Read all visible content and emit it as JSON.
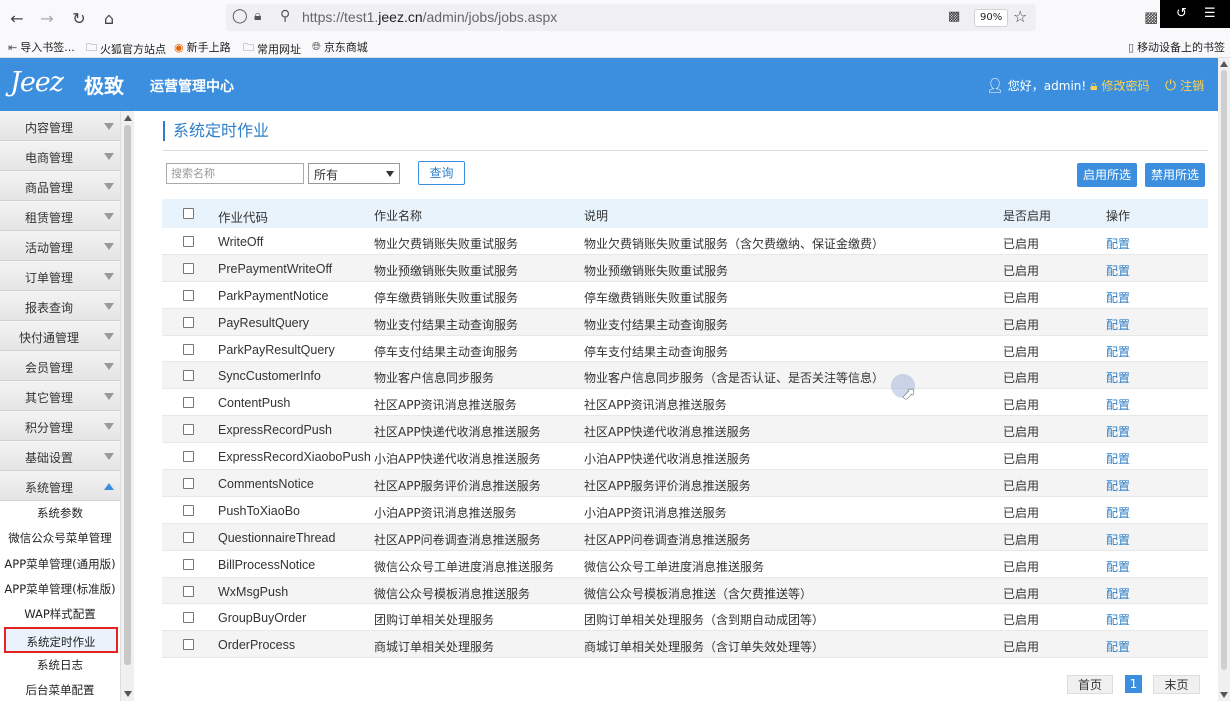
{
  "browser": {
    "url_prefix": "https://test1.",
    "url_domain": "jeez.cn",
    "url_suffix": "/admin/jobs/jobs.aspx",
    "zoom": "90%",
    "bookmarks": [
      "导入书签...",
      "火狐官方站点",
      "新手上路",
      "常用网址",
      "京东商城"
    ],
    "mobile_bookmarks": "移动设备上的书签"
  },
  "header": {
    "logo_en": "Jeez",
    "logo_cn": "极致",
    "center_title": "运营管理中心",
    "greeting": "您好，admin!",
    "change_password": "修改密码",
    "logout": "注销"
  },
  "sidebar": {
    "menus": [
      "内容管理",
      "电商管理",
      "商品管理",
      "租赁管理",
      "活动管理",
      "订单管理",
      "报表查询",
      "快付通管理",
      "会员管理",
      "其它管理",
      "积分管理",
      "基础设置"
    ],
    "expanded_menu": "系统管理",
    "sub_items": [
      "系统参数",
      "微信公众号菜单管理",
      "APP菜单管理(通用版)",
      "APP菜单管理(标准版)",
      "WAP样式配置",
      "系统定时作业",
      "系统日志",
      "后台菜单配置"
    ],
    "active_sub": "系统定时作业"
  },
  "page": {
    "title": "系统定时作业",
    "search_placeholder": "搜索名称",
    "filter_selected": "所有",
    "query_button": "查询",
    "enable_selected": "启用所选",
    "disable_selected": "禁用所选"
  },
  "table": {
    "headers": {
      "code": "作业代码",
      "name": "作业名称",
      "desc": "说明",
      "enabled": "是否启用",
      "op": "操作"
    },
    "rows": [
      {
        "code": "WriteOff",
        "name": "物业欠费销账失败重试服务",
        "desc": "物业欠费销账失败重试服务（含欠费缴纳、保证金缴费）",
        "enabled": "已启用",
        "op": "配置"
      },
      {
        "code": "PrePaymentWriteOff",
        "name": "物业预缴销账失败重试服务",
        "desc": "物业预缴销账失败重试服务",
        "enabled": "已启用",
        "op": "配置"
      },
      {
        "code": "ParkPaymentNotice",
        "name": "停车缴费销账失败重试服务",
        "desc": "停车缴费销账失败重试服务",
        "enabled": "已启用",
        "op": "配置"
      },
      {
        "code": "PayResultQuery",
        "name": "物业支付结果主动查询服务",
        "desc": "物业支付结果主动查询服务",
        "enabled": "已启用",
        "op": "配置"
      },
      {
        "code": "ParkPayResultQuery",
        "name": "停车支付结果主动查询服务",
        "desc": "停车支付结果主动查询服务",
        "enabled": "已启用",
        "op": "配置"
      },
      {
        "code": "SyncCustomerInfo",
        "name": "物业客户信息同步服务",
        "desc": "物业客户信息同步服务（含是否认证、是否关注等信息）",
        "enabled": "已启用",
        "op": "配置"
      },
      {
        "code": "ContentPush",
        "name": "社区APP资讯消息推送服务",
        "desc": "社区APP资讯消息推送服务",
        "enabled": "已启用",
        "op": "配置"
      },
      {
        "code": "ExpressRecordPush",
        "name": "社区APP快递代收消息推送服务",
        "desc": "社区APP快递代收消息推送服务",
        "enabled": "已启用",
        "op": "配置"
      },
      {
        "code": "ExpressRecordXiaoboPush",
        "name": "小泊APP快递代收消息推送服务",
        "desc": "小泊APP快递代收消息推送服务",
        "enabled": "已启用",
        "op": "配置"
      },
      {
        "code": "CommentsNotice",
        "name": "社区APP服务评价消息推送服务",
        "desc": "社区APP服务评价消息推送服务",
        "enabled": "已启用",
        "op": "配置"
      },
      {
        "code": "PushToXiaoBo",
        "name": "小泊APP资讯消息推送服务",
        "desc": "小泊APP资讯消息推送服务",
        "enabled": "已启用",
        "op": "配置"
      },
      {
        "code": "QuestionnaireThread",
        "name": "社区APP问卷调查消息推送服务",
        "desc": "社区APP问卷调查消息推送服务",
        "enabled": "已启用",
        "op": "配置"
      },
      {
        "code": "BillProcessNotice",
        "name": "微信公众号工单进度消息推送服务",
        "desc": "微信公众号工单进度消息推送服务",
        "enabled": "已启用",
        "op": "配置"
      },
      {
        "code": "WxMsgPush",
        "name": "微信公众号模板消息推送服务",
        "desc": "微信公众号模板消息推送（含欠费推送等）",
        "enabled": "已启用",
        "op": "配置"
      },
      {
        "code": "GroupBuyOrder",
        "name": "团购订单相关处理服务",
        "desc": "团购订单相关处理服务（含到期自动成团等）",
        "enabled": "已启用",
        "op": "配置"
      },
      {
        "code": "OrderProcess",
        "name": "商城订单相关处理服务",
        "desc": "商城订单相关处理服务（含订单失效处理等）",
        "enabled": "已启用",
        "op": "配置"
      }
    ]
  },
  "pager": {
    "first": "首页",
    "current": "1",
    "last": "末页"
  },
  "colors": {
    "brand": "#3b8fde",
    "active_border": "#e52222",
    "link": "#2f7fc8"
  }
}
